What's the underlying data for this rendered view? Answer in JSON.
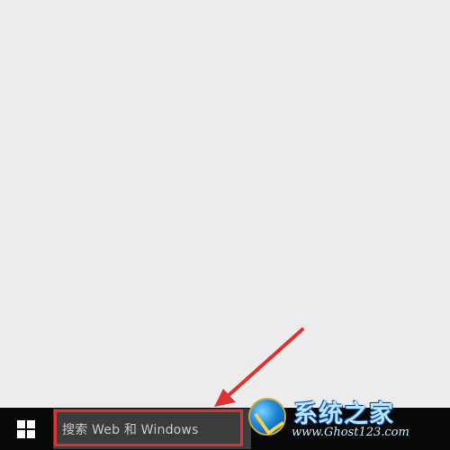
{
  "taskbar": {
    "start_icon": "windows-logo-icon",
    "search": {
      "placeholder": "搜索 Web 和 Windows"
    }
  },
  "annotation": {
    "highlight_color": "#e0302f",
    "arrow_color": "#e0302f"
  },
  "watermark": {
    "title": "系统之家",
    "url": "www.Ghost123.com"
  }
}
